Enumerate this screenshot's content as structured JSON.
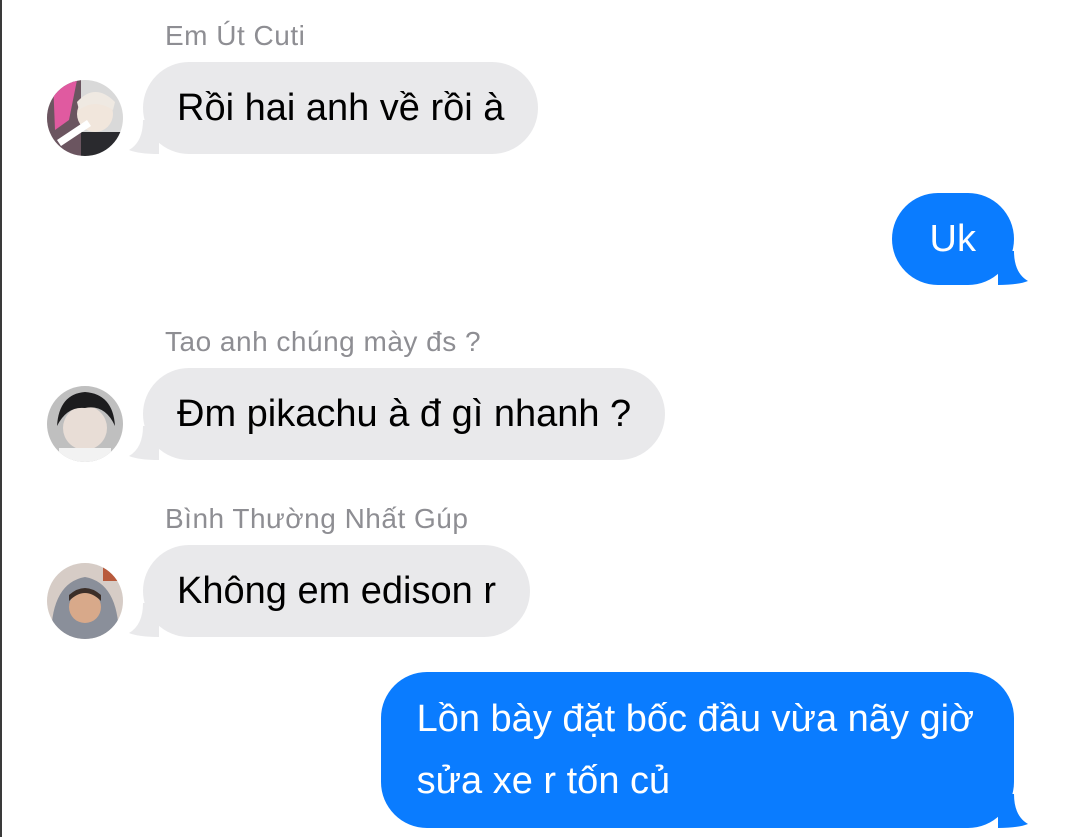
{
  "messages": [
    {
      "direction": "incoming",
      "sender": "Em Út Cuti",
      "avatar_icon": "user-avatar-pink-hair",
      "text": "Rồi hai anh về rồi à"
    },
    {
      "direction": "outgoing",
      "text": "Uk"
    },
    {
      "direction": "incoming",
      "sender": "Tao anh chúng mày đs ?",
      "avatar_icon": "user-avatar-dark-hair",
      "text": "Đm pikachu à đ gì nhanh ?"
    },
    {
      "direction": "incoming",
      "sender": "Bình Thường Nhất Gúp",
      "avatar_icon": "user-avatar-hoodie",
      "text": "Không em edison r"
    },
    {
      "direction": "outgoing",
      "text_line1": "Lồn bày đặt bốc đầu vừa nãy giờ",
      "text_line2": "sửa xe r tốn củ"
    }
  ],
  "colors": {
    "incoming_bubble": "#e9e9eb",
    "outgoing_bubble": "#0a7cff",
    "sender_name": "#8e8e93"
  }
}
